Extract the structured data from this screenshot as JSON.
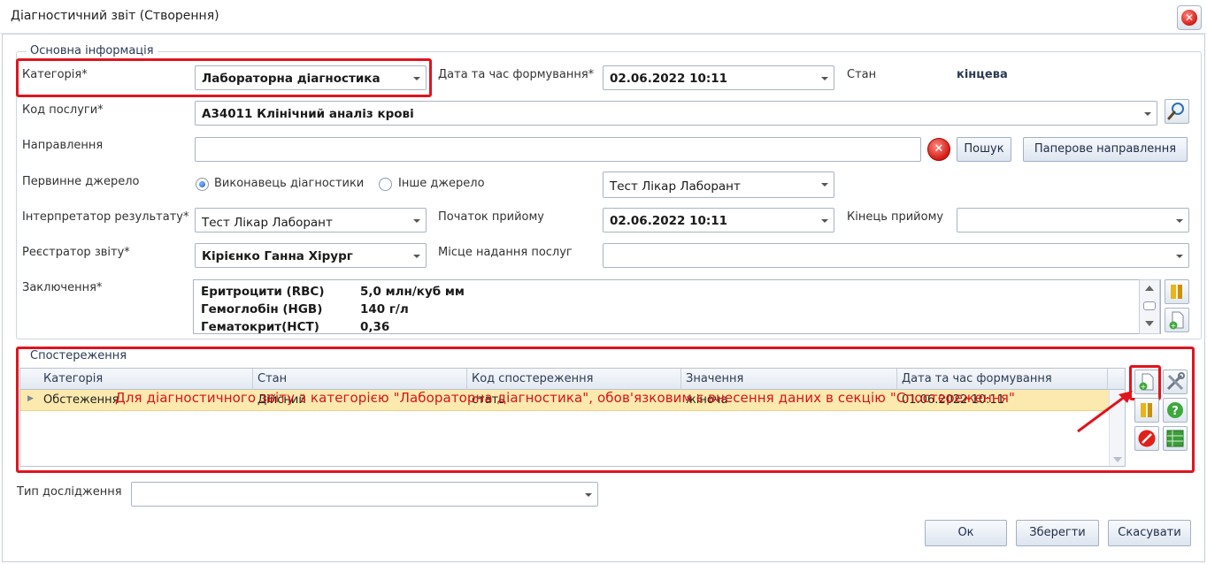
{
  "window": {
    "title": "Діагностичний звіт (Створення)"
  },
  "main_info": {
    "legend": "Основна інформація",
    "category": {
      "label": "Категорія*",
      "value": "Лабораторна діагностика"
    },
    "formed_at": {
      "label": "Дата та час формування*",
      "value": "02.06.2022 10:11"
    },
    "status": {
      "label": "Стан",
      "value": "кінцева"
    },
    "service_code": {
      "label": "Код послуги*",
      "value": "A34011 Клінічний аналіз крові"
    },
    "referral": {
      "label": "Направлення",
      "value": "",
      "search_label": "Пошук",
      "paper_label": "Паперове направлення"
    },
    "primary_source": {
      "label": "Первинне джерело",
      "option1": "Виконавець діагностики",
      "option2": "Інше джерело",
      "value": "Тест Лікар Лаборант"
    },
    "interpreter": {
      "label": "Інтерпретатор результату*",
      "value": "Тест Лікар Лаборант"
    },
    "visit_start": {
      "label": "Початок прийому",
      "value": "02.06.2022 10:11"
    },
    "visit_end": {
      "label": "Кінець прийому",
      "value": ""
    },
    "registrar": {
      "label": "Реєстратор звіту*",
      "value": "Кірієнко Ганна Хірург"
    },
    "service_place": {
      "label": "Місце надання послуг",
      "value": ""
    },
    "conclusion": {
      "label": "Заключення*",
      "lines": [
        {
          "name": "Еритроцити (RBC)",
          "value": "5,0 млн/куб мм"
        },
        {
          "name": "Гемоглобін (HGB)",
          "value": "140 г/л"
        },
        {
          "name": "Гематокрит(HCT)",
          "value": "0,36"
        }
      ]
    }
  },
  "observations": {
    "legend": "Спостереження",
    "columns": [
      "Категорія",
      "Стан",
      "Код спостереження",
      "Значення",
      "Дата та час формування"
    ],
    "rows": [
      [
        "Обстеження",
        "Дійсний",
        "стать",
        "жіноча",
        "01.06.2022 10:11"
      ]
    ],
    "annotation": "Для діагностичного звіту з категорією \"Лабораторна діагностика\", обов'язковим є внесення даних в секцію \"Спостереження\""
  },
  "study_type": {
    "label": "Тип дослідження",
    "value": ""
  },
  "footer": {
    "ok_label": "Ок",
    "save_label": "Зберегти",
    "cancel_label": "Скасувати"
  },
  "colors": {
    "highlight": "#e0141e",
    "selected_row": "#fbe9ad"
  }
}
